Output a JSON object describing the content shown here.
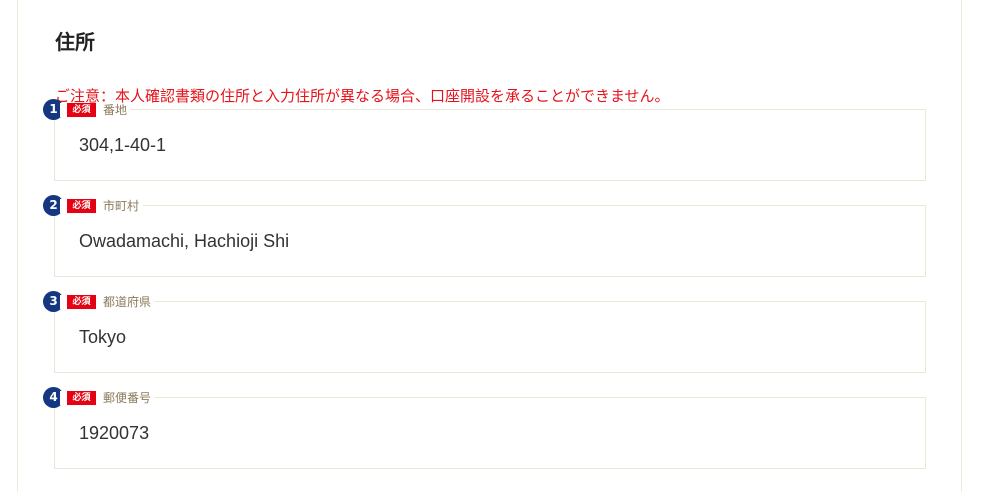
{
  "section": {
    "title": "住所",
    "notice": "ご注意：本人確認書類の住所と入力住所が異なる場合、口座開設を承ることができません。"
  },
  "fields": [
    {
      "number": "1",
      "required": "必須",
      "label": "番地",
      "value": "304,1-40-1"
    },
    {
      "number": "2",
      "required": "必須",
      "label": "市町村",
      "value": "Owadamachi, Hachioji Shi"
    },
    {
      "number": "3",
      "required": "必須",
      "label": "都道府県",
      "value": "Tokyo"
    },
    {
      "number": "4",
      "required": "必須",
      "label": "郵便番号",
      "value": "1920073"
    }
  ],
  "colors": {
    "badge_navy": "#143782",
    "required_red": "#e50012",
    "notice_red": "#e5131b",
    "label_brown": "#8c7b5b",
    "border_beige": "#ebe6d6"
  }
}
